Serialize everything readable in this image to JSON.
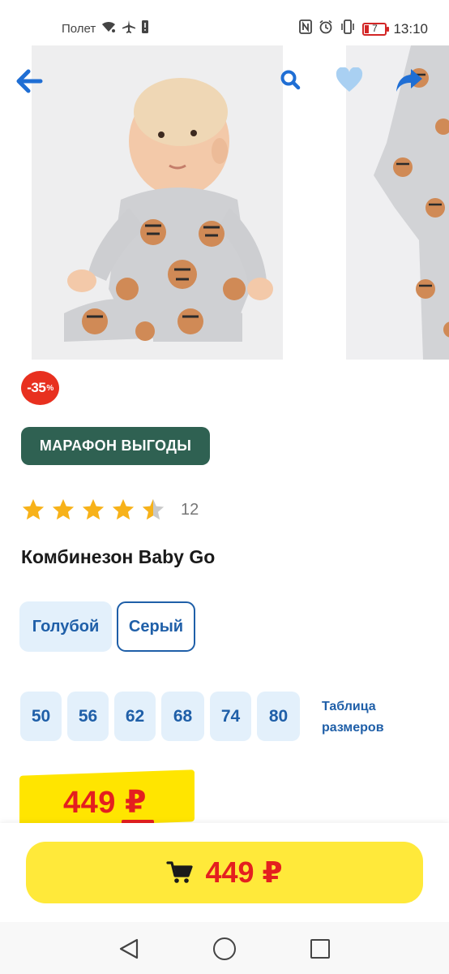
{
  "status_bar": {
    "airplane_label": "Полет",
    "time": "13:10",
    "battery_level": "7",
    "icons": [
      "wifi-icon",
      "airplane-icon",
      "alert-icon",
      "nfc-icon",
      "alarm-icon",
      "vibrate-icon",
      "battery-icon"
    ]
  },
  "header": {
    "back_icon": "arrow-left-icon",
    "search_icon": "search-icon",
    "favorite_icon": "heart-icon",
    "share_icon": "share-icon"
  },
  "gallery": {
    "images": [
      "baby-sitting-in-tiger-print-jumpsuit",
      "tiger-print-jumpsuit-flat"
    ]
  },
  "badge": {
    "discount": "-35",
    "discount_unit": "%"
  },
  "promo": {
    "label": "МАРАФОН ВЫГОДЫ"
  },
  "rating": {
    "value": 4.5,
    "max": 5,
    "count": "12"
  },
  "product": {
    "title": "Комбинезон Baby Go"
  },
  "colors": {
    "options": [
      {
        "label": "Голубой",
        "selected": false
      },
      {
        "label": "Серый",
        "selected": true
      }
    ]
  },
  "sizes": {
    "options": [
      "50",
      "56",
      "62",
      "68",
      "74",
      "80"
    ],
    "table_link": "Таблица размеров"
  },
  "price": {
    "value": "449 ₽"
  },
  "cart": {
    "icon": "cart-icon",
    "price": "449 ₽"
  },
  "nav": {
    "icons": [
      "nav-back-icon",
      "nav-home-icon",
      "nav-recent-icon"
    ]
  },
  "theme": {
    "accent_blue": "#1f5fa8",
    "chip_bg": "#e3f0fb",
    "promo_green": "#2f6152",
    "discount_red": "#e8301f",
    "price_red": "#e41f1f",
    "yellow": "#ffe93a",
    "star": "#f7b21a"
  }
}
